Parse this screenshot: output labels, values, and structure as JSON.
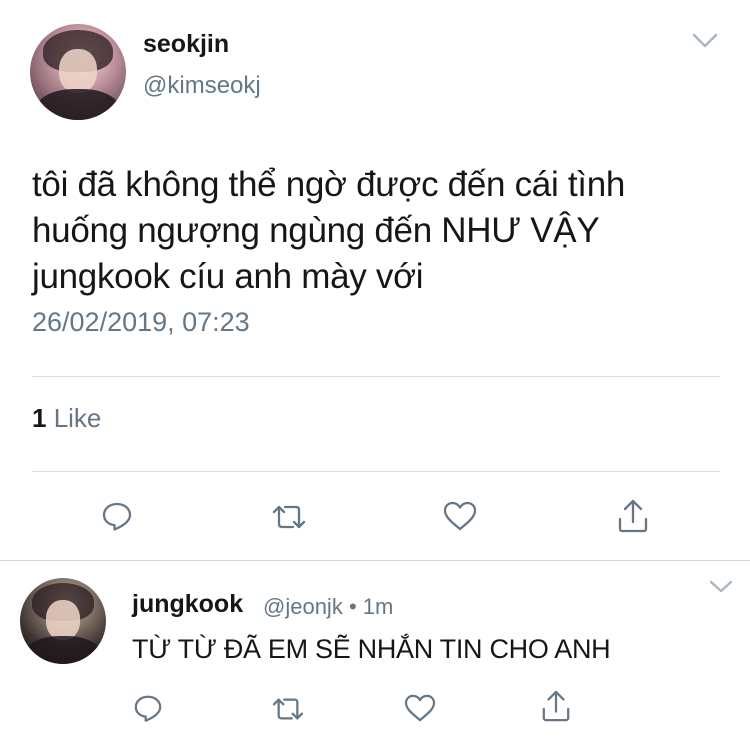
{
  "tweet": {
    "display_name": "seokjin",
    "handle": "@kimseokj",
    "text": "tôi đã không thể ngờ được đến cái tình\nhuống ngượng ngùng đến NHƯ VẬY\njungkook cíu anh mày với",
    "timestamp": "26/02/2019, 07:23",
    "like_count": "1",
    "like_label": " Like",
    "avatar_icon": "user-avatar",
    "menu_icon": "chevron-down-icon",
    "actions": [
      "reply-icon",
      "retweet-icon",
      "like-icon",
      "share-icon"
    ]
  },
  "reply": {
    "display_name": "jungkook",
    "handle": "@jeonjk",
    "separator": " • ",
    "time": "1m",
    "text": "TỪ TỪ ĐÃ EM SẼ NHẮN TIN CHO ANH",
    "avatar_icon": "user-avatar",
    "menu_icon": "chevron-down-icon",
    "actions": [
      "reply-icon",
      "retweet-icon",
      "like-icon",
      "share-icon"
    ]
  },
  "colors": {
    "text_primary": "#14171a",
    "text_secondary": "#657786",
    "divider": "#d8dfe3",
    "icon": "#657786"
  }
}
